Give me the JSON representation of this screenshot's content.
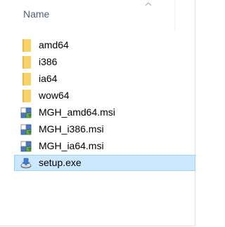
{
  "header": {
    "name_label": "Name"
  },
  "files": [
    {
      "name": "amd64",
      "type": "folder",
      "icon": "folder-icon",
      "selected": false
    },
    {
      "name": "i386",
      "type": "folder",
      "icon": "folder-icon",
      "selected": false
    },
    {
      "name": "ia64",
      "type": "folder",
      "icon": "folder-icon",
      "selected": false
    },
    {
      "name": "wow64",
      "type": "folder",
      "icon": "folder-icon",
      "selected": false
    },
    {
      "name": "MGH_amd64.msi",
      "type": "msi",
      "icon": "msi-installer-icon",
      "selected": false
    },
    {
      "name": "MGH_i386.msi",
      "type": "msi",
      "icon": "msi-installer-icon",
      "selected": false
    },
    {
      "name": "MGH_ia64.msi",
      "type": "msi",
      "icon": "msi-installer-icon",
      "selected": false
    },
    {
      "name": "setup.exe",
      "type": "exe",
      "icon": "setup-exe-icon",
      "selected": true
    }
  ],
  "colors": {
    "header_text": "#4c607a",
    "selection_bg": "#cce8ff",
    "selection_border": "#99d1ff",
    "folder": "#f6d36b"
  }
}
